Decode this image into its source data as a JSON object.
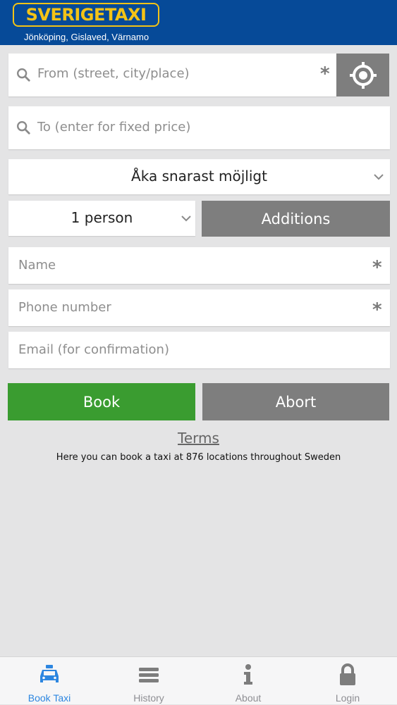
{
  "header": {
    "logo": "SVERIGETAXI",
    "subtitle": "Jönköping, Gislaved, Värnamo"
  },
  "form": {
    "from_placeholder": "From (street, city/place)",
    "to_placeholder": "To (enter for fixed price)",
    "time_selected": "Åka snarast möjligt",
    "persons_selected": "1 person",
    "additions_label": "Additions",
    "name_placeholder": "Name",
    "phone_placeholder": "Phone number",
    "email_placeholder": "Email (for confirmation)",
    "required_mark": "*"
  },
  "actions": {
    "book_label": "Book",
    "abort_label": "Abort"
  },
  "footer": {
    "terms_label": "Terms",
    "info_text": "Here you can book a taxi at 876 locations throughout Sweden"
  },
  "tabs": [
    {
      "label": "Book Taxi",
      "icon": "taxi-icon",
      "active": true
    },
    {
      "label": "History",
      "icon": "list-icon",
      "active": false
    },
    {
      "label": "About",
      "icon": "info-icon",
      "active": false
    },
    {
      "label": "Login",
      "icon": "lock-icon",
      "active": false
    }
  ],
  "colors": {
    "header_bg": "#064a98",
    "logo_yellow": "#f3c316",
    "book_green": "#3a9c30",
    "gray_button": "#7e7e7e",
    "active_tab": "#2c86e0"
  }
}
